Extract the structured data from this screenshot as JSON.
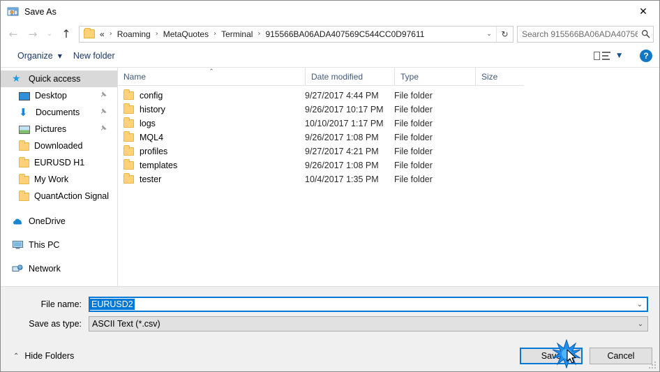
{
  "window": {
    "title": "Save As",
    "title_icon": "save-as-icon",
    "close_label": "✕"
  },
  "nav": {
    "back_icon": "←",
    "forward_icon": "→",
    "recent_icon": "⌄",
    "up_icon": "↑",
    "breadcrumbs": [
      "«",
      "Roaming",
      "MetaQuotes",
      "Terminal",
      "915566BA06ADA407569C544CC0D97611"
    ],
    "separator": "›",
    "dropdown_icon": "⌄",
    "refresh_icon": "↻"
  },
  "search": {
    "placeholder": "Search 915566BA06ADA40756...",
    "icon": "⌕"
  },
  "toolbar": {
    "organize_label": "Organize",
    "organize_caret": "▼",
    "new_folder_label": "New folder",
    "view_caret": "▼",
    "help_label": "?"
  },
  "sidebar": {
    "items": [
      {
        "label": "Quick access",
        "icon": "star-icon",
        "icon_class": "ic-star",
        "glyph": "★",
        "selected": true,
        "group": true,
        "pinned": false
      },
      {
        "label": "Desktop",
        "icon": "desktop-icon",
        "icon_class": "ic-desktop",
        "glyph": "",
        "selected": false,
        "group": false,
        "pinned": true
      },
      {
        "label": "Documents",
        "icon": "documents-icon",
        "icon_class": "ic-down",
        "glyph": "⬇",
        "selected": false,
        "group": false,
        "pinned": true
      },
      {
        "label": "Pictures",
        "icon": "pictures-icon",
        "icon_class": "ic-pic",
        "glyph": "",
        "selected": false,
        "group": false,
        "pinned": true
      },
      {
        "label": "Downloaded",
        "icon": "folder-icon",
        "icon_class": "ic-folder",
        "glyph": "",
        "selected": false,
        "group": false,
        "pinned": false
      },
      {
        "label": "EURUSD H1",
        "icon": "folder-icon",
        "icon_class": "ic-folder",
        "glyph": "",
        "selected": false,
        "group": false,
        "pinned": false
      },
      {
        "label": "My Work",
        "icon": "folder-icon",
        "icon_class": "ic-folder",
        "glyph": "",
        "selected": false,
        "group": false,
        "pinned": false
      },
      {
        "label": "QuantAction Signal",
        "icon": "folder-icon",
        "icon_class": "ic-folder",
        "glyph": "",
        "selected": false,
        "group": false,
        "pinned": false
      },
      {
        "label": "OneDrive",
        "icon": "onedrive-icon",
        "icon_class": "ic-cloud",
        "glyph": "☁",
        "selected": false,
        "group": true,
        "pinned": false
      },
      {
        "label": "This PC",
        "icon": "this-pc-icon",
        "icon_class": "ic-pc",
        "glyph": "",
        "selected": false,
        "group": true,
        "pinned": false
      },
      {
        "label": "Network",
        "icon": "network-icon",
        "icon_class": "ic-net",
        "glyph": "⚇",
        "selected": false,
        "group": true,
        "pinned": false
      }
    ],
    "pin_glyph": "✒"
  },
  "filelist": {
    "columns": [
      "Name",
      "Date modified",
      "Type",
      "Size"
    ],
    "sort_caret": "⌃",
    "rows": [
      {
        "name": "config",
        "date": "9/27/2017 4:44 PM",
        "type": "File folder",
        "size": ""
      },
      {
        "name": "history",
        "date": "9/26/2017 10:17 PM",
        "type": "File folder",
        "size": ""
      },
      {
        "name": "logs",
        "date": "10/10/2017 1:17 PM",
        "type": "File folder",
        "size": ""
      },
      {
        "name": "MQL4",
        "date": "9/26/2017 1:08 PM",
        "type": "File folder",
        "size": ""
      },
      {
        "name": "profiles",
        "date": "9/27/2017 4:21 PM",
        "type": "File folder",
        "size": ""
      },
      {
        "name": "templates",
        "date": "9/26/2017 1:08 PM",
        "type": "File folder",
        "size": ""
      },
      {
        "name": "tester",
        "date": "10/4/2017 1:35 PM",
        "type": "File folder",
        "size": ""
      }
    ]
  },
  "form": {
    "filename_label": "File name:",
    "filename_value": "EURUSD2",
    "filetype_label": "Save as type:",
    "filetype_value": "ASCII Text (*.csv)",
    "dropdown_icon": "⌄"
  },
  "footer": {
    "hide_folders_label": "Hide Folders",
    "hide_folders_caret": "⌃",
    "save_label": "Save",
    "cancel_label": "Cancel"
  },
  "colors": {
    "accent": "#0078d7",
    "folder": "#ffd277",
    "selection": "#d9d9d9",
    "column_header_text": "#41597a",
    "toolbar_text": "#1a3a63"
  }
}
